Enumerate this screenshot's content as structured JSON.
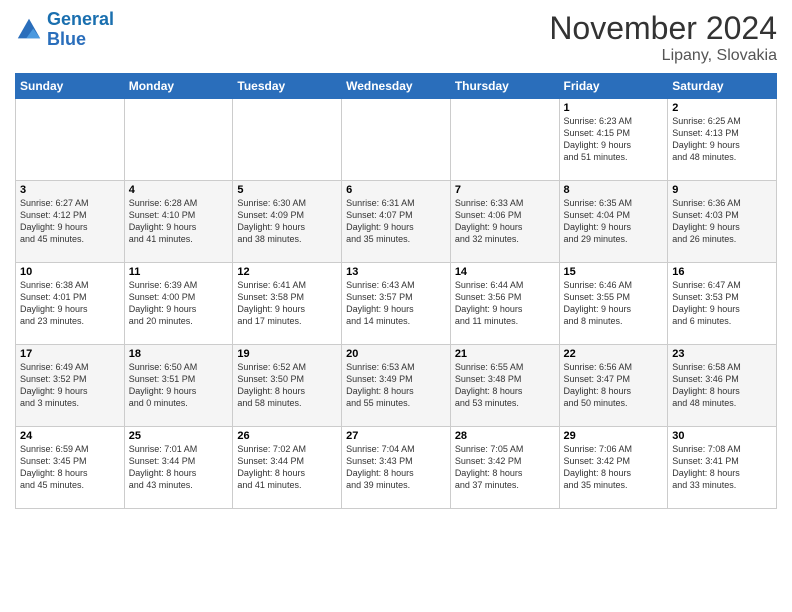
{
  "logo": {
    "line1": "General",
    "line2": "Blue"
  },
  "title": "November 2024",
  "subtitle": "Lipany, Slovakia",
  "days_header": [
    "Sunday",
    "Monday",
    "Tuesday",
    "Wednesday",
    "Thursday",
    "Friday",
    "Saturday"
  ],
  "weeks": [
    [
      {
        "day": "",
        "info": ""
      },
      {
        "day": "",
        "info": ""
      },
      {
        "day": "",
        "info": ""
      },
      {
        "day": "",
        "info": ""
      },
      {
        "day": "",
        "info": ""
      },
      {
        "day": "1",
        "info": "Sunrise: 6:23 AM\nSunset: 4:15 PM\nDaylight: 9 hours\nand 51 minutes."
      },
      {
        "day": "2",
        "info": "Sunrise: 6:25 AM\nSunset: 4:13 PM\nDaylight: 9 hours\nand 48 minutes."
      }
    ],
    [
      {
        "day": "3",
        "info": "Sunrise: 6:27 AM\nSunset: 4:12 PM\nDaylight: 9 hours\nand 45 minutes."
      },
      {
        "day": "4",
        "info": "Sunrise: 6:28 AM\nSunset: 4:10 PM\nDaylight: 9 hours\nand 41 minutes."
      },
      {
        "day": "5",
        "info": "Sunrise: 6:30 AM\nSunset: 4:09 PM\nDaylight: 9 hours\nand 38 minutes."
      },
      {
        "day": "6",
        "info": "Sunrise: 6:31 AM\nSunset: 4:07 PM\nDaylight: 9 hours\nand 35 minutes."
      },
      {
        "day": "7",
        "info": "Sunrise: 6:33 AM\nSunset: 4:06 PM\nDaylight: 9 hours\nand 32 minutes."
      },
      {
        "day": "8",
        "info": "Sunrise: 6:35 AM\nSunset: 4:04 PM\nDaylight: 9 hours\nand 29 minutes."
      },
      {
        "day": "9",
        "info": "Sunrise: 6:36 AM\nSunset: 4:03 PM\nDaylight: 9 hours\nand 26 minutes."
      }
    ],
    [
      {
        "day": "10",
        "info": "Sunrise: 6:38 AM\nSunset: 4:01 PM\nDaylight: 9 hours\nand 23 minutes."
      },
      {
        "day": "11",
        "info": "Sunrise: 6:39 AM\nSunset: 4:00 PM\nDaylight: 9 hours\nand 20 minutes."
      },
      {
        "day": "12",
        "info": "Sunrise: 6:41 AM\nSunset: 3:58 PM\nDaylight: 9 hours\nand 17 minutes."
      },
      {
        "day": "13",
        "info": "Sunrise: 6:43 AM\nSunset: 3:57 PM\nDaylight: 9 hours\nand 14 minutes."
      },
      {
        "day": "14",
        "info": "Sunrise: 6:44 AM\nSunset: 3:56 PM\nDaylight: 9 hours\nand 11 minutes."
      },
      {
        "day": "15",
        "info": "Sunrise: 6:46 AM\nSunset: 3:55 PM\nDaylight: 9 hours\nand 8 minutes."
      },
      {
        "day": "16",
        "info": "Sunrise: 6:47 AM\nSunset: 3:53 PM\nDaylight: 9 hours\nand 6 minutes."
      }
    ],
    [
      {
        "day": "17",
        "info": "Sunrise: 6:49 AM\nSunset: 3:52 PM\nDaylight: 9 hours\nand 3 minutes."
      },
      {
        "day": "18",
        "info": "Sunrise: 6:50 AM\nSunset: 3:51 PM\nDaylight: 9 hours\nand 0 minutes."
      },
      {
        "day": "19",
        "info": "Sunrise: 6:52 AM\nSunset: 3:50 PM\nDaylight: 8 hours\nand 58 minutes."
      },
      {
        "day": "20",
        "info": "Sunrise: 6:53 AM\nSunset: 3:49 PM\nDaylight: 8 hours\nand 55 minutes."
      },
      {
        "day": "21",
        "info": "Sunrise: 6:55 AM\nSunset: 3:48 PM\nDaylight: 8 hours\nand 53 minutes."
      },
      {
        "day": "22",
        "info": "Sunrise: 6:56 AM\nSunset: 3:47 PM\nDaylight: 8 hours\nand 50 minutes."
      },
      {
        "day": "23",
        "info": "Sunrise: 6:58 AM\nSunset: 3:46 PM\nDaylight: 8 hours\nand 48 minutes."
      }
    ],
    [
      {
        "day": "24",
        "info": "Sunrise: 6:59 AM\nSunset: 3:45 PM\nDaylight: 8 hours\nand 45 minutes."
      },
      {
        "day": "25",
        "info": "Sunrise: 7:01 AM\nSunset: 3:44 PM\nDaylight: 8 hours\nand 43 minutes."
      },
      {
        "day": "26",
        "info": "Sunrise: 7:02 AM\nSunset: 3:44 PM\nDaylight: 8 hours\nand 41 minutes."
      },
      {
        "day": "27",
        "info": "Sunrise: 7:04 AM\nSunset: 3:43 PM\nDaylight: 8 hours\nand 39 minutes."
      },
      {
        "day": "28",
        "info": "Sunrise: 7:05 AM\nSunset: 3:42 PM\nDaylight: 8 hours\nand 37 minutes."
      },
      {
        "day": "29",
        "info": "Sunrise: 7:06 AM\nSunset: 3:42 PM\nDaylight: 8 hours\nand 35 minutes."
      },
      {
        "day": "30",
        "info": "Sunrise: 7:08 AM\nSunset: 3:41 PM\nDaylight: 8 hours\nand 33 minutes."
      }
    ]
  ]
}
